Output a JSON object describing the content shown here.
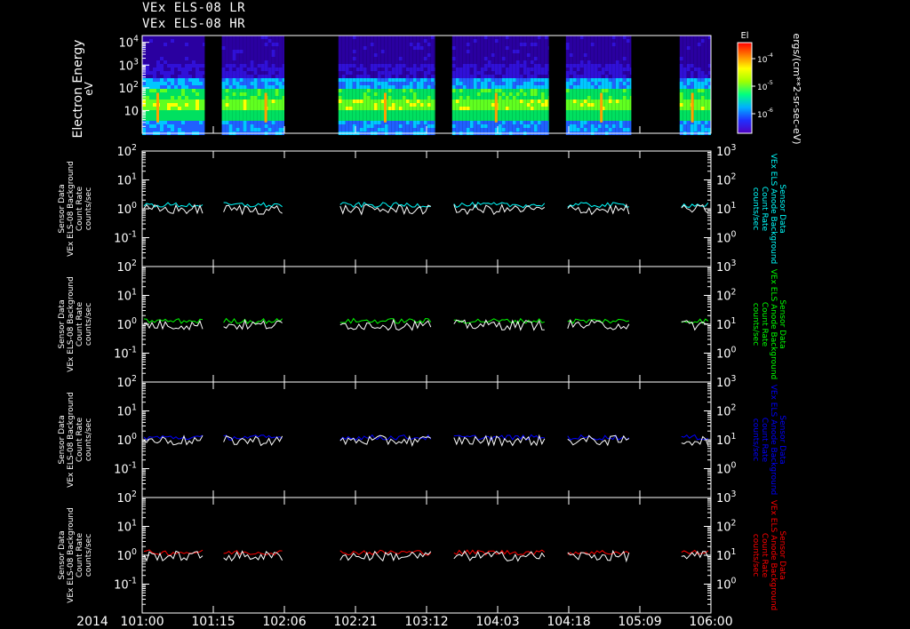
{
  "header": {
    "title_lr": "VEx ELS-08 LR",
    "title_hr": "VEx ELS-08 HR"
  },
  "colors": {
    "background": "#000000",
    "axes": "#ffffff",
    "sensor_trace": "#ffffff",
    "panel1": "#00ffff",
    "panel2": "#00ff00",
    "panel3": "#0000ff",
    "panel4": "#ff0000"
  },
  "time_axis": {
    "start_label": "2014",
    "tick_labels": [
      "101:00",
      "101:15",
      "102:06",
      "102:21",
      "103:12",
      "104:03",
      "104:18",
      "105:09",
      "106:00"
    ]
  },
  "spectrogram": {
    "ylabel_line1": "Electron Energy",
    "ylabel_line2": "eV",
    "yscale": "log",
    "ylim": [
      1,
      20000
    ],
    "yticks": [
      "10",
      "10^2",
      "10^3",
      "10^4"
    ],
    "colorbar_title": "El",
    "colorbar_label": "ergs/(cm**2-sr-sec-eV)",
    "colorbar_ticks": [
      "10^-4",
      "10^-5",
      "10^-6"
    ],
    "data_blocks": [
      [
        0.0,
        0.11
      ],
      [
        0.14,
        0.25
      ],
      [
        0.345,
        0.515
      ],
      [
        0.545,
        0.715
      ],
      [
        0.745,
        0.86
      ],
      [
        0.945,
        1.0
      ]
    ],
    "flux_band_eV": [
      5,
      300
    ],
    "spike_times": [
      0.025,
      0.215,
      0.425,
      0.62,
      0.805,
      0.965
    ]
  },
  "chart_data": [
    {
      "type": "line",
      "ylabel_left": [
        "VEx ELS-08 Background",
        "Sensor Data",
        "Count Rate",
        "counts/sec"
      ],
      "ylabel_right": [
        "VEx ELS Anode Background",
        "Sensor Data",
        "Count Rate",
        "counts/sec"
      ],
      "yscale": "log",
      "ylim_left": [
        0.01,
        100
      ],
      "ylim_right": [
        0.1,
        1000
      ],
      "yticks_left": [
        "10^-1",
        "10^0",
        "10^1",
        "10^2"
      ],
      "yticks_right": [
        "10^0",
        "10^1",
        "10^2",
        "10^3"
      ],
      "series": [
        {
          "color": "#00ffff",
          "level": 1.35
        },
        {
          "color": "#ffffff",
          "level": 0.8
        }
      ]
    },
    {
      "type": "line",
      "ylabel_left": [
        "VEx ELS-08 Background",
        "Sensor Data",
        "Count Rate",
        "counts/sec"
      ],
      "ylabel_right": [
        "VEx ELS Anode Background",
        "Sensor Data",
        "Count Rate",
        "counts/sec"
      ],
      "yscale": "log",
      "ylim_left": [
        0.01,
        100
      ],
      "ylim_right": [
        0.1,
        1000
      ],
      "yticks_left": [
        "10^-1",
        "10^0",
        "10^1",
        "10^2"
      ],
      "yticks_right": [
        "10^0",
        "10^1",
        "10^2",
        "10^3"
      ],
      "series": [
        {
          "color": "#00ff00",
          "level": 1.3
        },
        {
          "color": "#ffffff",
          "level": 0.8
        }
      ]
    },
    {
      "type": "line",
      "ylabel_left": [
        "VEx ELS-08 Background",
        "Sensor Data",
        "Count Rate",
        "counts/sec"
      ],
      "ylabel_right": [
        "VEx ELS Anode Background",
        "Sensor Data",
        "Count Rate",
        "counts/sec"
      ],
      "yscale": "log",
      "ylim_left": [
        0.01,
        100
      ],
      "ylim_right": [
        0.1,
        1000
      ],
      "yticks_left": [
        "10^-1",
        "10^0",
        "10^1",
        "10^2"
      ],
      "yticks_right": [
        "10^0",
        "10^1",
        "10^2",
        "10^3"
      ],
      "series": [
        {
          "color": "#0000ff",
          "level": 1.2
        },
        {
          "color": "#ffffff",
          "level": 0.8
        }
      ]
    },
    {
      "type": "line",
      "ylabel_left": [
        "VEx ELS-08 Background",
        "Sensor Data",
        "Count Rate",
        "counts/sec"
      ],
      "ylabel_right": [
        "VEx ELS Anode Background",
        "Sensor Data",
        "Count Rate",
        "counts/sec"
      ],
      "yscale": "log",
      "ylim_left": [
        0.01,
        100
      ],
      "ylim_right": [
        0.1,
        1000
      ],
      "yticks_left": [
        "10^-1",
        "10^0",
        "10^1",
        "10^2"
      ],
      "yticks_right": [
        "10^0",
        "10^1",
        "10^2",
        "10^3"
      ],
      "series": [
        {
          "color": "#ff0000",
          "level": 1.25
        },
        {
          "color": "#ffffff",
          "level": 0.8
        }
      ]
    }
  ]
}
